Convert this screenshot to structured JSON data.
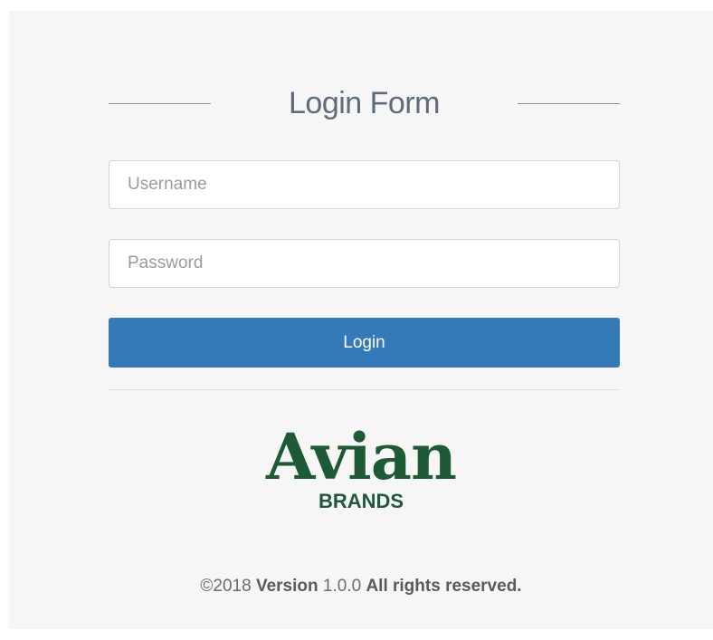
{
  "form": {
    "title": "Login Form",
    "username_placeholder": "Username",
    "password_placeholder": "Password",
    "login_label": "Login"
  },
  "logo": {
    "main": "Avian",
    "sub": "BRANDS",
    "color": "#1e5a36"
  },
  "footer": {
    "copyright": "©2018",
    "version_label": "Version",
    "version_number": "1.0.0",
    "rights": "All rights reserved."
  },
  "colors": {
    "button": "#337ab7",
    "panel": "#f6f6f6"
  }
}
